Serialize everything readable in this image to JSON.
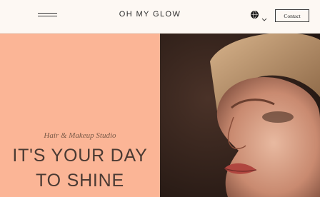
{
  "header": {
    "brand": "OH MY GLOW",
    "menu_icon": "hamburger-menu-icon",
    "language_icon": "globe-icon",
    "language_chevron": "chevron-down-icon",
    "contact_label": "Contact"
  },
  "hero": {
    "subtitle": "Hair & Makeup Studio",
    "headline_line1": "IT'S YOUR DAY",
    "headline_line2": "TO SHINE",
    "background_color": "#fbb596",
    "text_color": "#4a3a33",
    "image": "woman-portrait-photo"
  }
}
